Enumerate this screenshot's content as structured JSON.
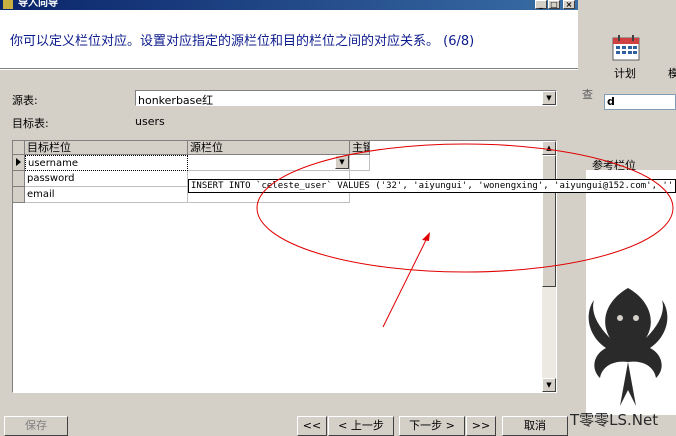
{
  "window": {
    "title": "导入向导"
  },
  "header": {
    "instruction": "你可以定义栏位对应。设置对应指定的源栏位和目的栏位之间的对应关系。 (6/8)"
  },
  "form": {
    "source_label": "源表:",
    "source_value": "honkerbase红",
    "target_label": "目标表:",
    "target_value": "users"
  },
  "grid": {
    "headers": {
      "target": "目标栏位",
      "source": "源栏位",
      "primary": "主键"
    },
    "rows": [
      {
        "target": "username",
        "source": ""
      },
      {
        "target": "password",
        "source": ""
      },
      {
        "target": "email",
        "source": ""
      }
    ],
    "dropdown_item": "INSERT INTO `celeste_user` VALUES ('32', 'aiyungui', 'wonengxing', 'aiyungui@152.com', '',"
  },
  "buttons": {
    "save": "保存",
    "first": "<<",
    "prev": "< 上一步",
    "next": "下一步 >",
    "last": ">>",
    "cancel": "取消"
  },
  "background_window": {
    "plan_label": "计划",
    "extra_label": "模",
    "search_label": "查",
    "search_value": "d",
    "ref_column_label": "参考栏位"
  },
  "watermark": {
    "text": "T零零LS.Net"
  },
  "colors": {
    "instruction_text": "#0b1a8c",
    "annotation": "#e00000",
    "dialog_bg": "#d4d0c8"
  }
}
